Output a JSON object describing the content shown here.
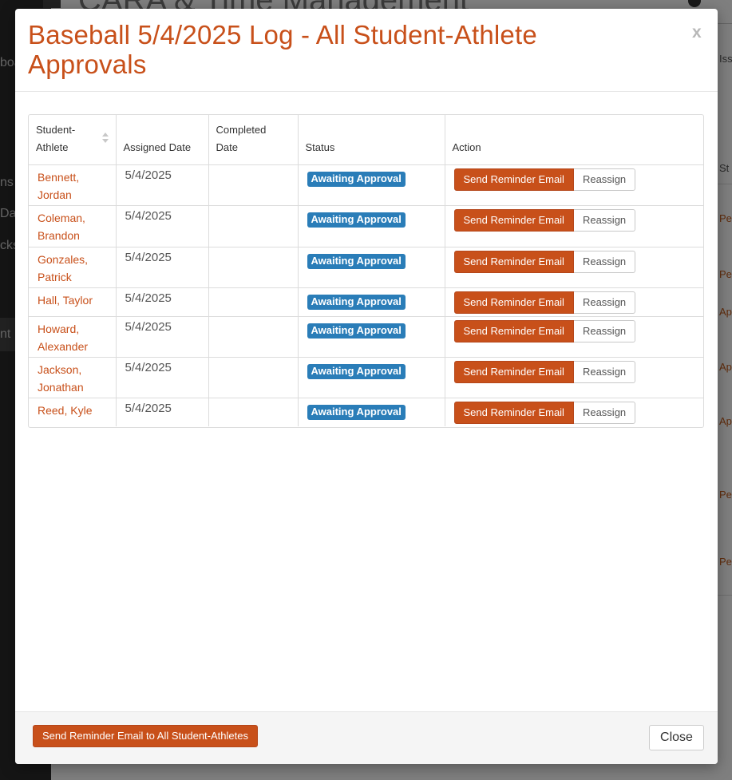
{
  "background": {
    "page_title": "CARA & Time Management",
    "sidebar_labels": [
      "boa",
      "ns",
      "Da",
      "cks",
      "nt"
    ],
    "right_column_labels": [
      "Issu",
      "St",
      "Pe",
      "Pe",
      "Ap",
      "Ap",
      "Ap",
      "Pe",
      "Pe"
    ]
  },
  "modal": {
    "title": "Baseball 5/4/2025 Log - All Student-Athlete Approvals",
    "close_x": "x",
    "table": {
      "headers": {
        "student_athlete": "Student-Athlete",
        "assigned_date": "Assigned Date",
        "completed_date": "Completed Date",
        "status": "Status",
        "action": "Action"
      },
      "rows": [
        {
          "name": "Bennett, Jordan",
          "assigned": "5/4/2025",
          "completed": "",
          "status": "Awaiting Approval",
          "reminder": "Send Reminder Email",
          "reassign": "Reassign"
        },
        {
          "name": "Coleman, Brandon",
          "assigned": "5/4/2025",
          "completed": "",
          "status": "Awaiting Approval",
          "reminder": "Send Reminder Email",
          "reassign": "Reassign"
        },
        {
          "name": "Gonzales, Patrick",
          "assigned": "5/4/2025",
          "completed": "",
          "status": "Awaiting Approval",
          "reminder": "Send Reminder Email",
          "reassign": "Reassign"
        },
        {
          "name": "Hall, Taylor",
          "assigned": "5/4/2025",
          "completed": "",
          "status": "Awaiting Approval",
          "reminder": "Send Reminder Email",
          "reassign": "Reassign"
        },
        {
          "name": "Howard, Alexander",
          "assigned": "5/4/2025",
          "completed": "",
          "status": "Awaiting Approval",
          "reminder": "Send Reminder Email",
          "reassign": "Reassign"
        },
        {
          "name": "Jackson, Jonathan",
          "assigned": "5/4/2025",
          "completed": "",
          "status": "Awaiting Approval",
          "reminder": "Send Reminder Email",
          "reassign": "Reassign"
        },
        {
          "name": "Reed, Kyle",
          "assigned": "5/4/2025",
          "completed": "",
          "status": "Awaiting Approval",
          "reminder": "Send Reminder Email",
          "reassign": "Reassign"
        }
      ]
    },
    "footer": {
      "send_all_label": "Send Reminder Email to All Student-Athletes",
      "close_label": "Close"
    }
  },
  "colors": {
    "accent": "#c8501a",
    "status_badge": "#2a7db8"
  },
  "icons": {
    "sort": "sort-icon",
    "close": "close-icon"
  }
}
